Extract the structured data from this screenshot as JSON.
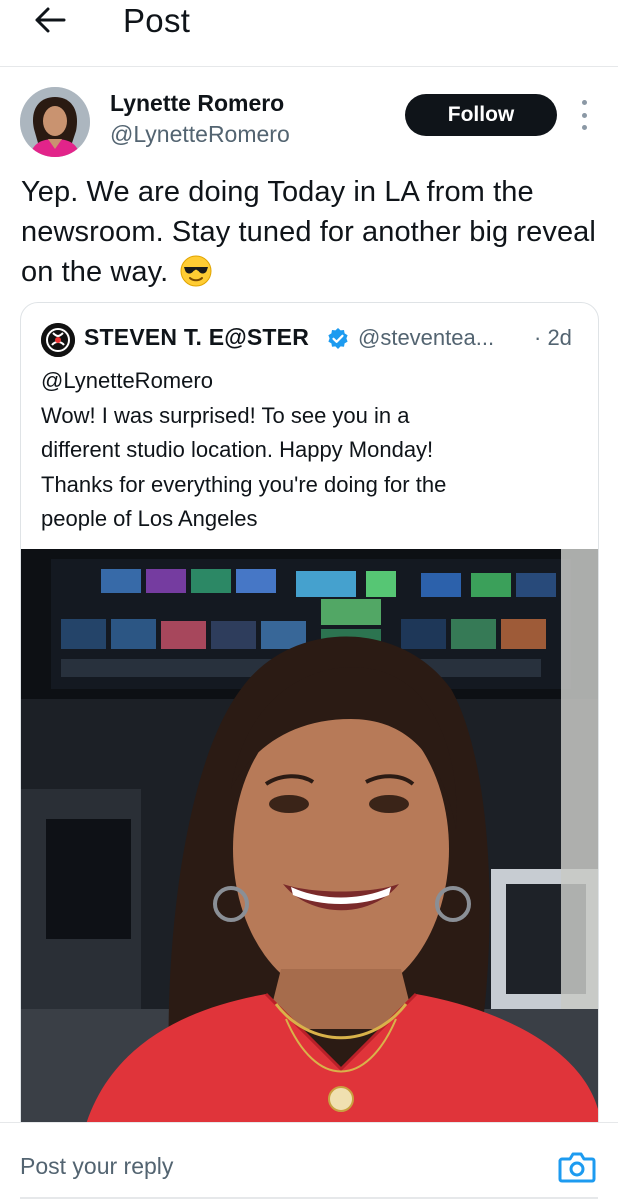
{
  "header": {
    "title": "Post",
    "back_icon": "arrow-left-icon"
  },
  "post": {
    "author": {
      "name": "Lynette Romero",
      "handle": "@LynetteRomero"
    },
    "follow_label": "Follow",
    "text": "Yep. We are doing Today in LA from the newsroom. Stay tuned for another big reveal on the way.",
    "emoji": "smiling-face-with-sunglasses"
  },
  "quote": {
    "author": {
      "name": "STEVEN T. E@STER",
      "handle": "@steventea...",
      "verified": true
    },
    "time": "· 2d",
    "text_lines": [
      "@LynetteRomero",
      "Wow! I was surprised! To see you in a",
      "different studio location. Happy Monday!",
      "Thanks for everything you're doing for the",
      "people of Los Angeles"
    ]
  },
  "reply": {
    "placeholder": "Post your reply",
    "camera_icon": "camera-icon"
  },
  "colors": {
    "text_primary": "#0f1419",
    "text_secondary": "#536471",
    "follow_bg": "#0f1419",
    "verified_blue": "#1d9bf0",
    "camera_blue": "#1d9bf0"
  }
}
